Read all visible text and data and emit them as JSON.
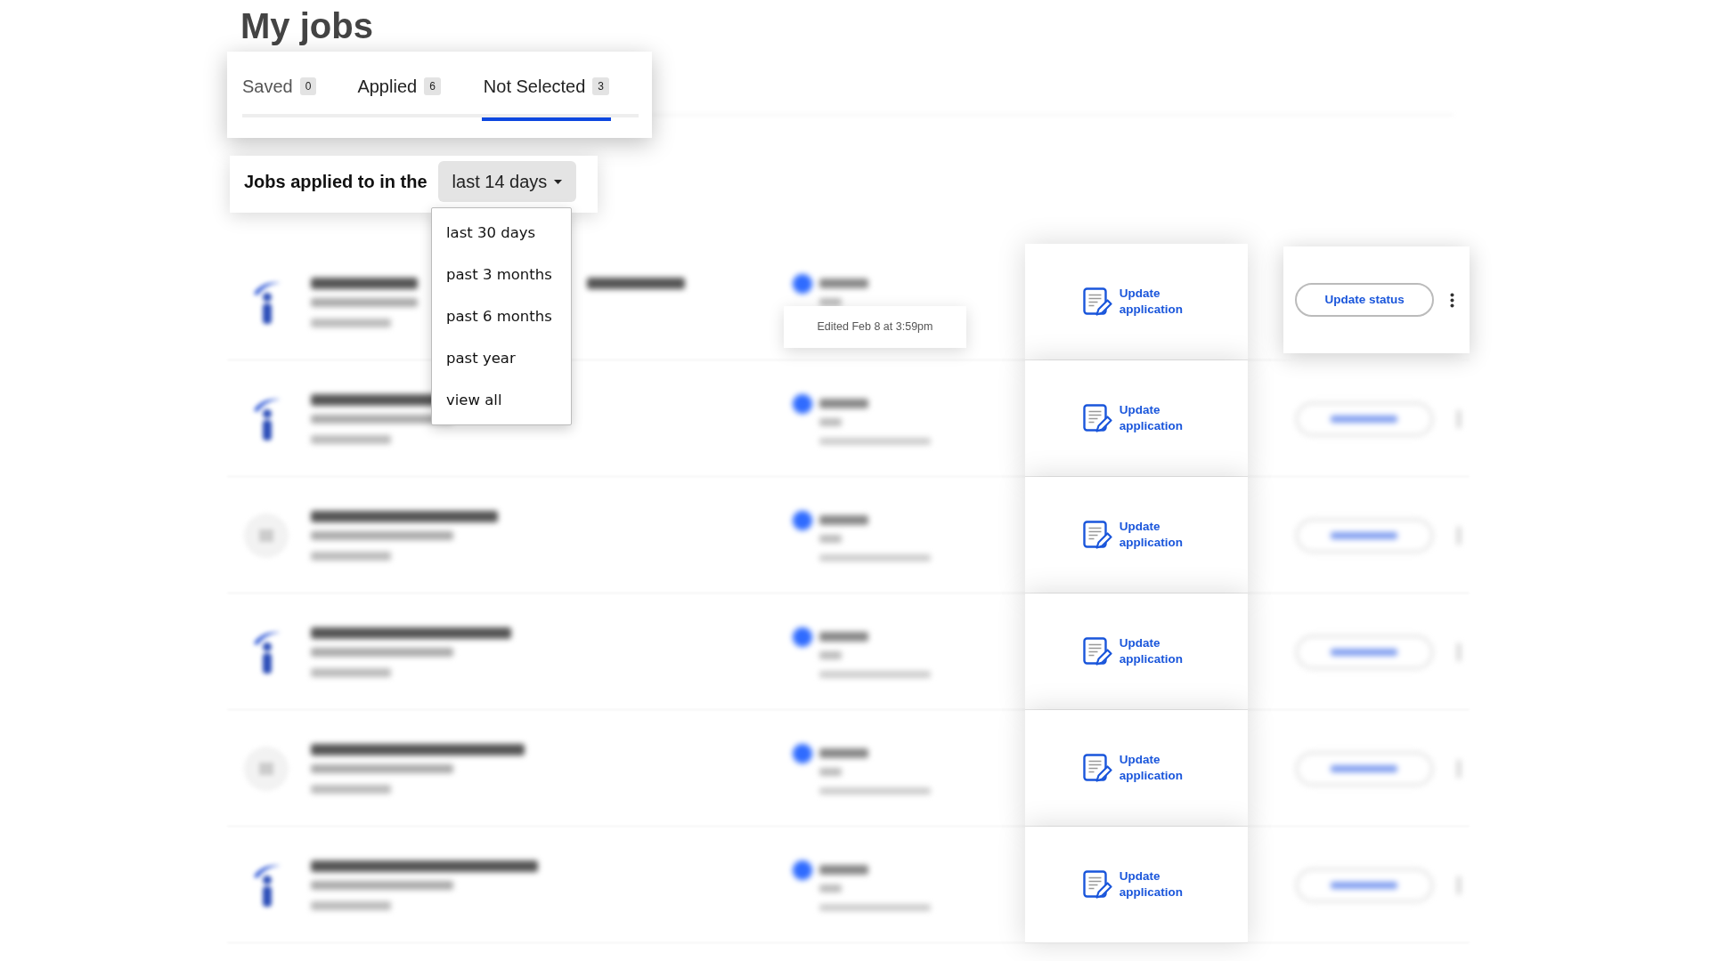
{
  "title": "My jobs",
  "tabs": [
    {
      "label": "Saved",
      "count": "0",
      "selected": false
    },
    {
      "label": "Applied",
      "count": "6",
      "selected": false
    },
    {
      "label": "Not Selected",
      "count": "3",
      "selected": true
    }
  ],
  "filter": {
    "label": "Jobs applied to in the",
    "value": "last 14 days",
    "options": [
      "last 30 days",
      "past 3 months",
      "past 6 months",
      "past year",
      "view all"
    ]
  },
  "jobs": [
    {
      "kind": "brand",
      "focused": true,
      "edited_note": "Edited Feb 8 at 3:59pm",
      "action": "Update application",
      "status_button": "Update status"
    },
    {
      "kind": "brand",
      "focused": false,
      "action": "Update application"
    },
    {
      "kind": "generic",
      "focused": false,
      "action": "Update application"
    },
    {
      "kind": "brand",
      "focused": false,
      "action": "Update application"
    },
    {
      "kind": "generic",
      "focused": false,
      "action": "Update application"
    },
    {
      "kind": "brand",
      "focused": false,
      "action": "Update application"
    }
  ]
}
